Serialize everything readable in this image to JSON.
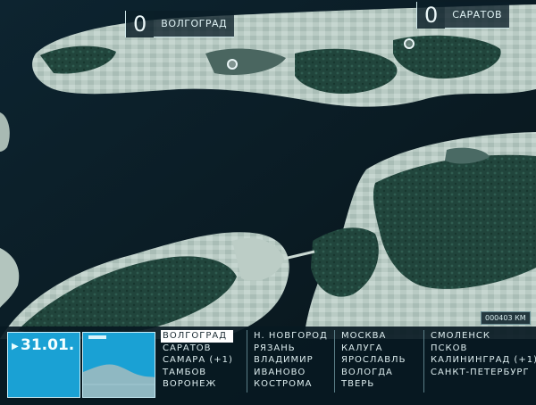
{
  "markers": [
    {
      "count": "0",
      "name": "ВОЛГОГРАД"
    },
    {
      "count": "0",
      "name": "САРАТОВ"
    }
  ],
  "scale": "000403 КМ",
  "hud": {
    "date": "31.01.",
    "columns": [
      [
        "ВОЛГОГРАД",
        "САРАТОВ",
        "САМАРА (+1)",
        "ТАМБОВ",
        "ВОРОНЕЖ"
      ],
      [
        "Н. НОВГОРОД",
        "РЯЗАНЬ",
        "ВЛАДИМИР",
        "ИВАНОВО",
        "КОСТРОМА"
      ],
      [
        "МОСКВА",
        "КАЛУГА",
        "ЯРОСЛАВЛЬ",
        "ВОЛОГДА",
        "ТВЕРЬ"
      ],
      [
        "СМОЛЕНСК",
        "ПСКОВ",
        "КАЛИНИНГРАД (+1)",
        "САНКТ-ПЕТЕРБУРГ"
      ]
    ],
    "active_city": "ВОЛГОГРАД"
  },
  "colors": {
    "water": "#0b1a22",
    "land": "#c7d6cf",
    "forest": "#1f4a3e",
    "hud_accent": "#1aa1d4"
  }
}
